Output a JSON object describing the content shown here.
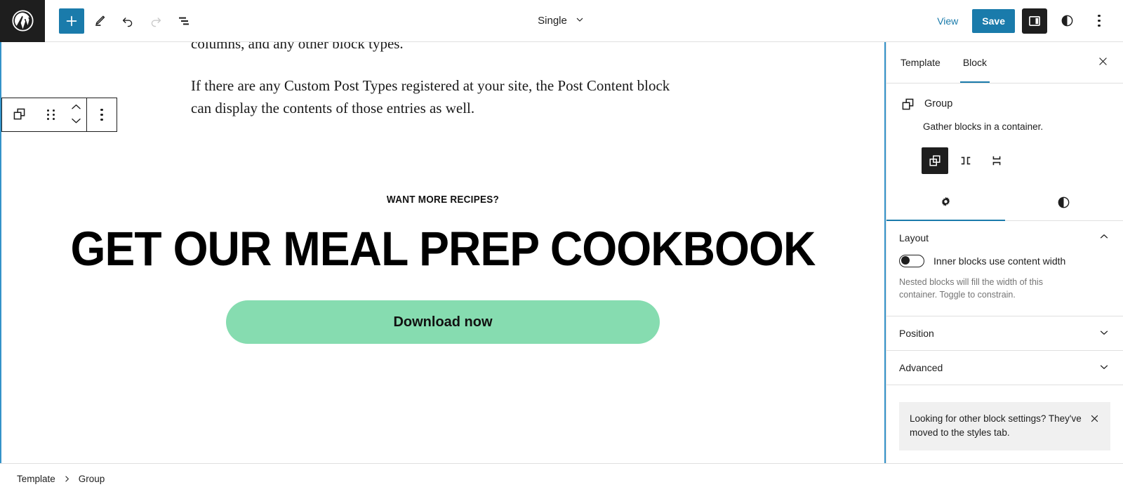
{
  "header": {
    "logo_icon": "wordpress-logo-icon",
    "tools": [
      {
        "name": "add-block-button",
        "icon": "plus-icon",
        "label": "Add block"
      },
      {
        "name": "edit-tool-button",
        "icon": "pencil-icon",
        "label": "Tools"
      },
      {
        "name": "undo-button",
        "icon": "undo-icon",
        "label": "Undo"
      },
      {
        "name": "redo-button",
        "icon": "redo-icon",
        "label": "Redo"
      },
      {
        "name": "document-overview-button",
        "icon": "list-view-icon",
        "label": "Document Overview"
      }
    ],
    "document_title": "Single",
    "document_title_icon": "chevron-down-icon",
    "view_label": "View",
    "save_label": "Save",
    "settings_toggle_icon": "sidebar-panel-icon",
    "styles_icon": "styles-contrast-icon",
    "more_options_icon": "three-dots-vertical-icon"
  },
  "block_toolbar": {
    "block_type_icon": "group-block-icon",
    "drag_handle_icon": "drag-handle-icon",
    "move_up_icon": "chevron-up-icon",
    "move_down_icon": "chevron-down-icon",
    "more_options_icon": "three-dots-vertical-icon"
  },
  "canvas": {
    "paragraphs": [
      "columns, and any other block types.",
      "If there are any Custom Post Types registered at your site, the Post Content block can display the contents of those entries as well."
    ],
    "cta": {
      "eyebrow": "WANT MORE RECIPES?",
      "heading": "GET OUR MEAL PREP COOKBOOK",
      "button_label": "Download now",
      "button_color": "#86dcb0",
      "button_text_color": "#111111"
    },
    "selection_color": "#3593c9"
  },
  "sidebar": {
    "tabs": [
      {
        "name": "tab-template",
        "label": "Template",
        "active": false
      },
      {
        "name": "tab-block",
        "label": "Block",
        "active": true
      }
    ],
    "close_icon": "close-icon",
    "block": {
      "icon": "group-block-icon",
      "title": "Group",
      "description": "Gather blocks in a container.",
      "variations": [
        {
          "name": "variation-group",
          "icon": "group-icon",
          "label": "Group",
          "selected": true
        },
        {
          "name": "variation-row",
          "icon": "row-icon",
          "label": "Row",
          "selected": false
        },
        {
          "name": "variation-stack",
          "icon": "stack-icon",
          "label": "Stack",
          "selected": false
        }
      ]
    },
    "icon_tabs": [
      {
        "name": "tab-settings",
        "icon": "gear-icon",
        "active": true
      },
      {
        "name": "tab-styles",
        "icon": "styles-contrast-icon",
        "active": false
      }
    ],
    "panels": [
      {
        "name": "panel-layout",
        "title": "Layout",
        "expanded": true,
        "chevron_icon": "chevron-up-icon",
        "toggle": {
          "name": "inner-blocks-content-width-toggle",
          "label": "Inner blocks use content width",
          "checked": false
        },
        "help_text": "Nested blocks will fill the width of this container. Toggle to constrain."
      },
      {
        "name": "panel-position",
        "title": "Position",
        "expanded": false,
        "chevron_icon": "chevron-down-icon"
      },
      {
        "name": "panel-advanced",
        "title": "Advanced",
        "expanded": false,
        "chevron_icon": "chevron-down-icon"
      }
    ],
    "notice": {
      "text": "Looking for other block settings? They've moved to the styles tab.",
      "close_icon": "close-icon"
    }
  },
  "footer": {
    "breadcrumb": [
      "Template",
      "Group"
    ],
    "separator_icon": "chevron-right-icon"
  },
  "colors": {
    "accent_blue": "#1a7bab",
    "selection_blue": "#3593c9",
    "dark": "#1e1e1e",
    "cta_green": "#86dcb0",
    "notice_bg": "#f0f0f0"
  }
}
